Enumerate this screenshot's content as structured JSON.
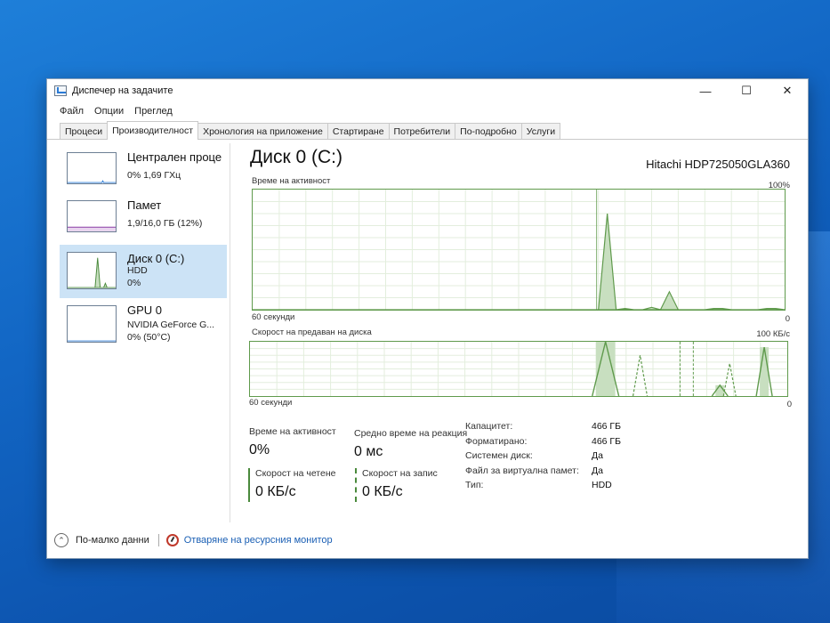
{
  "window": {
    "title": "Диспечер на задачите",
    "controls": {
      "minimize": "—",
      "maximize": "☐",
      "close": "✕"
    }
  },
  "menu": [
    "Файл",
    "Опции",
    "Преглед"
  ],
  "tabs": [
    {
      "label": "Процеси",
      "active": false
    },
    {
      "label": "Производителност",
      "active": true
    },
    {
      "label": "Хронология на приложение",
      "active": false
    },
    {
      "label": "Стартиране",
      "active": false
    },
    {
      "label": "Потребители",
      "active": false
    },
    {
      "label": "По-подробно",
      "active": false
    },
    {
      "label": "Услуги",
      "active": false
    }
  ],
  "sidebar": {
    "items": [
      {
        "title": "Централен проце",
        "line1": "0%  1,69 ГХц",
        "line2": "",
        "selected": false
      },
      {
        "title": "Памет",
        "line1": "1,9/16,0 ГБ (12%)",
        "line2": "",
        "selected": false
      },
      {
        "title": "Диск 0 (C:)",
        "line1": "HDD",
        "line2": "0%",
        "selected": true
      },
      {
        "title": "GPU 0",
        "line1": "NVIDIA GeForce G...",
        "line2": "0%  (50°C)",
        "selected": false
      }
    ]
  },
  "main": {
    "title": "Диск 0 (C:)",
    "model": "Hitachi HDP725050GLA360",
    "activity_graph": {
      "label": "Време на активност",
      "max_label": "100%",
      "time_label": "60 секунди",
      "min_label": "0",
      "peaks_percent": [
        0,
        0,
        0,
        0,
        0,
        0,
        0,
        0,
        0,
        0,
        0,
        0,
        0,
        0,
        0,
        0,
        0,
        0,
        0,
        0,
        0,
        0,
        0,
        0,
        0,
        0,
        0,
        0,
        0,
        0,
        0,
        0,
        0,
        0,
        0,
        0,
        0,
        0,
        0,
        0,
        80,
        0,
        1,
        0,
        0,
        2,
        0,
        15,
        0,
        0,
        0,
        0,
        1,
        1,
        0,
        0,
        0,
        0,
        1,
        1,
        0
      ]
    },
    "transfer_graph": {
      "label": "Скорост на предаван на диска",
      "max_label": "100 КБ/с",
      "time_label": "60 секунди",
      "min_label": "0"
    },
    "stats": {
      "activity_label": "Време на активност",
      "activity_value": "0%",
      "response_label": "Средно време на реакция",
      "response_value": "0 мс",
      "read_label": "Скорост на четене",
      "read_value": "0 КБ/с",
      "write_label": "Скорост на запис",
      "write_value": "0 КБ/с"
    },
    "properties": [
      {
        "key": "Капацитет:",
        "value": "466 ГБ"
      },
      {
        "key": "Форматирано:",
        "value": "466 ГБ"
      },
      {
        "key": "Системен диск:",
        "value": "Да"
      },
      {
        "key": "Файл за виртуална памет:",
        "value": "Да"
      },
      {
        "key": "Тип:",
        "value": "HDD"
      }
    ]
  },
  "footer": {
    "less_details": "По-малко данни",
    "resource_monitor": "Отваряне на ресурсния монитор"
  },
  "colors": {
    "graph_line": "#5f9a4c",
    "graph_fill": "#c8dfc0",
    "selected_bg": "#cce3f6",
    "link": "#1a5fb4"
  }
}
